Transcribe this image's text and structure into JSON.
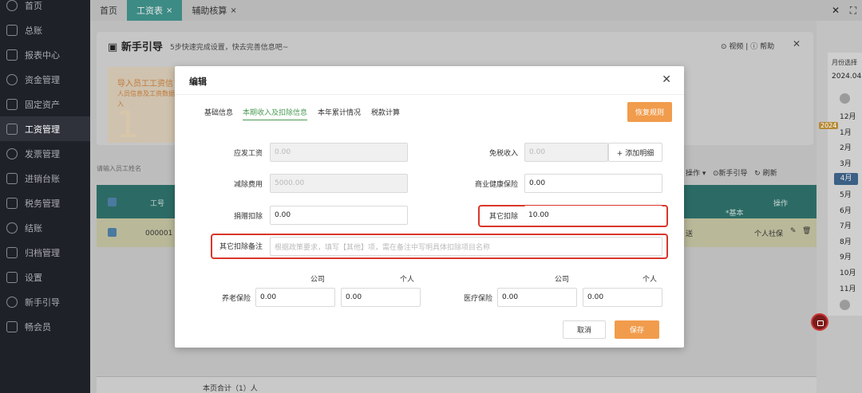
{
  "sidebar": {
    "items": [
      {
        "label": "首页",
        "icon": "home-icon"
      },
      {
        "label": "总账",
        "icon": "ledger-icon"
      },
      {
        "label": "报表中心",
        "icon": "chart-icon"
      },
      {
        "label": "资金管理",
        "icon": "money-icon"
      },
      {
        "label": "固定资产",
        "icon": "asset-icon"
      },
      {
        "label": "工资管理",
        "icon": "salary-icon"
      },
      {
        "label": "发票管理",
        "icon": "invoice-icon"
      },
      {
        "label": "进销台账",
        "icon": "inventory-icon"
      },
      {
        "label": "税务管理",
        "icon": "tax-icon"
      },
      {
        "label": "结账",
        "icon": "close-books-icon"
      },
      {
        "label": "归档管理",
        "icon": "archive-icon"
      },
      {
        "label": "设置",
        "icon": "gear-icon"
      },
      {
        "label": "新手引导",
        "icon": "guide-icon"
      },
      {
        "label": "畅会员",
        "icon": "vip-icon"
      }
    ],
    "active_index": 5
  },
  "tabs": [
    {
      "label": "首页",
      "closable": false
    },
    {
      "label": "工资表",
      "closable": true
    },
    {
      "label": "辅助核算",
      "closable": true
    }
  ],
  "guide": {
    "title": "新手引导",
    "subtitle": "5步快速完成设置，快去完善信息吧~",
    "video": "视频",
    "help": "帮助",
    "card_title": "导入员工工资信",
    "card_desc": "人员信息及工资数据导入",
    "card_num": "1"
  },
  "table": {
    "search_placeholder": "请输入员工姓名",
    "ops": "操作",
    "guide_link": "新手引导",
    "refresh": "刷新",
    "headers": {
      "id": "工号",
      "basic": "*基本",
      "action": "操作"
    },
    "row": {
      "id": "000001",
      "status": "送",
      "action": "个人社保"
    },
    "footer": "本页合计（1）人"
  },
  "month_panel": {
    "title": "月份选择",
    "year": "2024.04",
    "year_badge": "2024",
    "months": [
      "12月",
      "1月",
      "2月",
      "3月",
      "4月",
      "5月",
      "6月",
      "7月",
      "8月",
      "9月",
      "10月",
      "11月"
    ],
    "active": "4月"
  },
  "modal": {
    "title": "编辑",
    "tabs": [
      "基础信息",
      "本期收入及扣除信息",
      "本年累计情况",
      "税款计算"
    ],
    "active_tab": 1,
    "restore_rule": "恢复规则",
    "fields": {
      "gross_salary": {
        "label": "应发工资",
        "value": "0.00"
      },
      "tax_free_income": {
        "label": "免税收入",
        "value": "0.00"
      },
      "add_detail": "+ 添加明细",
      "deduction_fee": {
        "label": "减除费用",
        "value": "5000.00"
      },
      "health_insurance": {
        "label": "商业健康保险",
        "value": "0.00"
      },
      "donation": {
        "label": "捐赠扣除",
        "value": "0.00"
      },
      "other_deduction": {
        "label": "其它扣除",
        "value": "10.00"
      },
      "other_deduction_note": {
        "label": "其它扣除备注",
        "placeholder": "根据政策要求，填写【其他】项，需在备注中写明具体扣除项目名称"
      }
    },
    "insurance": {
      "company_label": "公司",
      "personal_label": "个人",
      "pension": {
        "label": "养老保险",
        "company": "0.00",
        "personal": "0.00"
      },
      "medical": {
        "label": "医疗保险",
        "company": "0.00",
        "personal": "0.00"
      }
    },
    "cancel": "取消",
    "save": "保存"
  }
}
